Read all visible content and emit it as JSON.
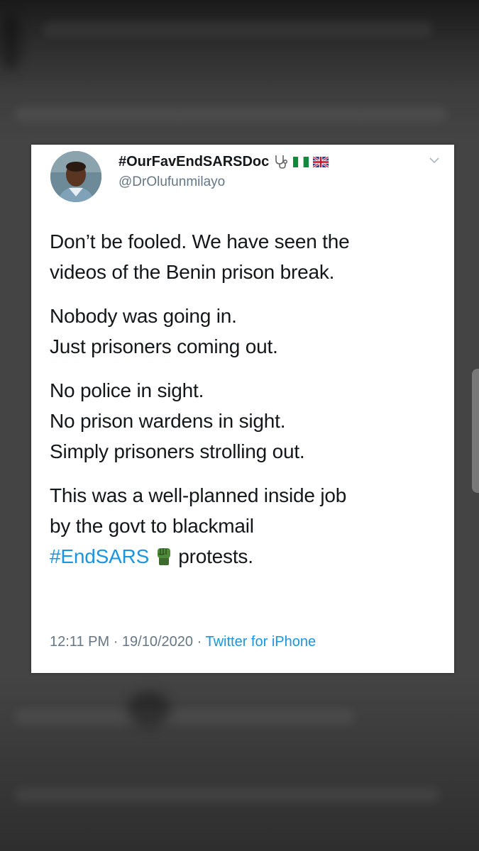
{
  "tweet": {
    "display_name": "#OurFavEndSARSDoc",
    "handle": "@DrOlufunmilayo",
    "name_icons": [
      "stethoscope-icon",
      "nigeria-flag-icon",
      "uk-flag-icon"
    ],
    "paragraphs": [
      {
        "lines": [
          "Don’t be fooled. We have seen the",
          "videos of the Benin prison break."
        ]
      },
      {
        "lines": [
          "Nobody was going in.",
          "Just prisoners coming out."
        ]
      },
      {
        "lines": [
          "No police in sight.",
          "No prison wardens in sight.",
          "Simply prisoners strolling out."
        ]
      },
      {
        "lines": [
          "This was a well-planned inside job",
          "by the govt to blackmail"
        ],
        "hashtag": "#EndSARS",
        "hashtag_icon": "raised-fist-icon",
        "after_hashtag": "protests."
      }
    ],
    "time": "12:11 PM",
    "date": "19/10/2020",
    "separator": "·",
    "source": "Twitter for iPhone"
  },
  "colors": {
    "link": "#1b95e0",
    "text": "#14171a",
    "secondary": "#657786"
  }
}
